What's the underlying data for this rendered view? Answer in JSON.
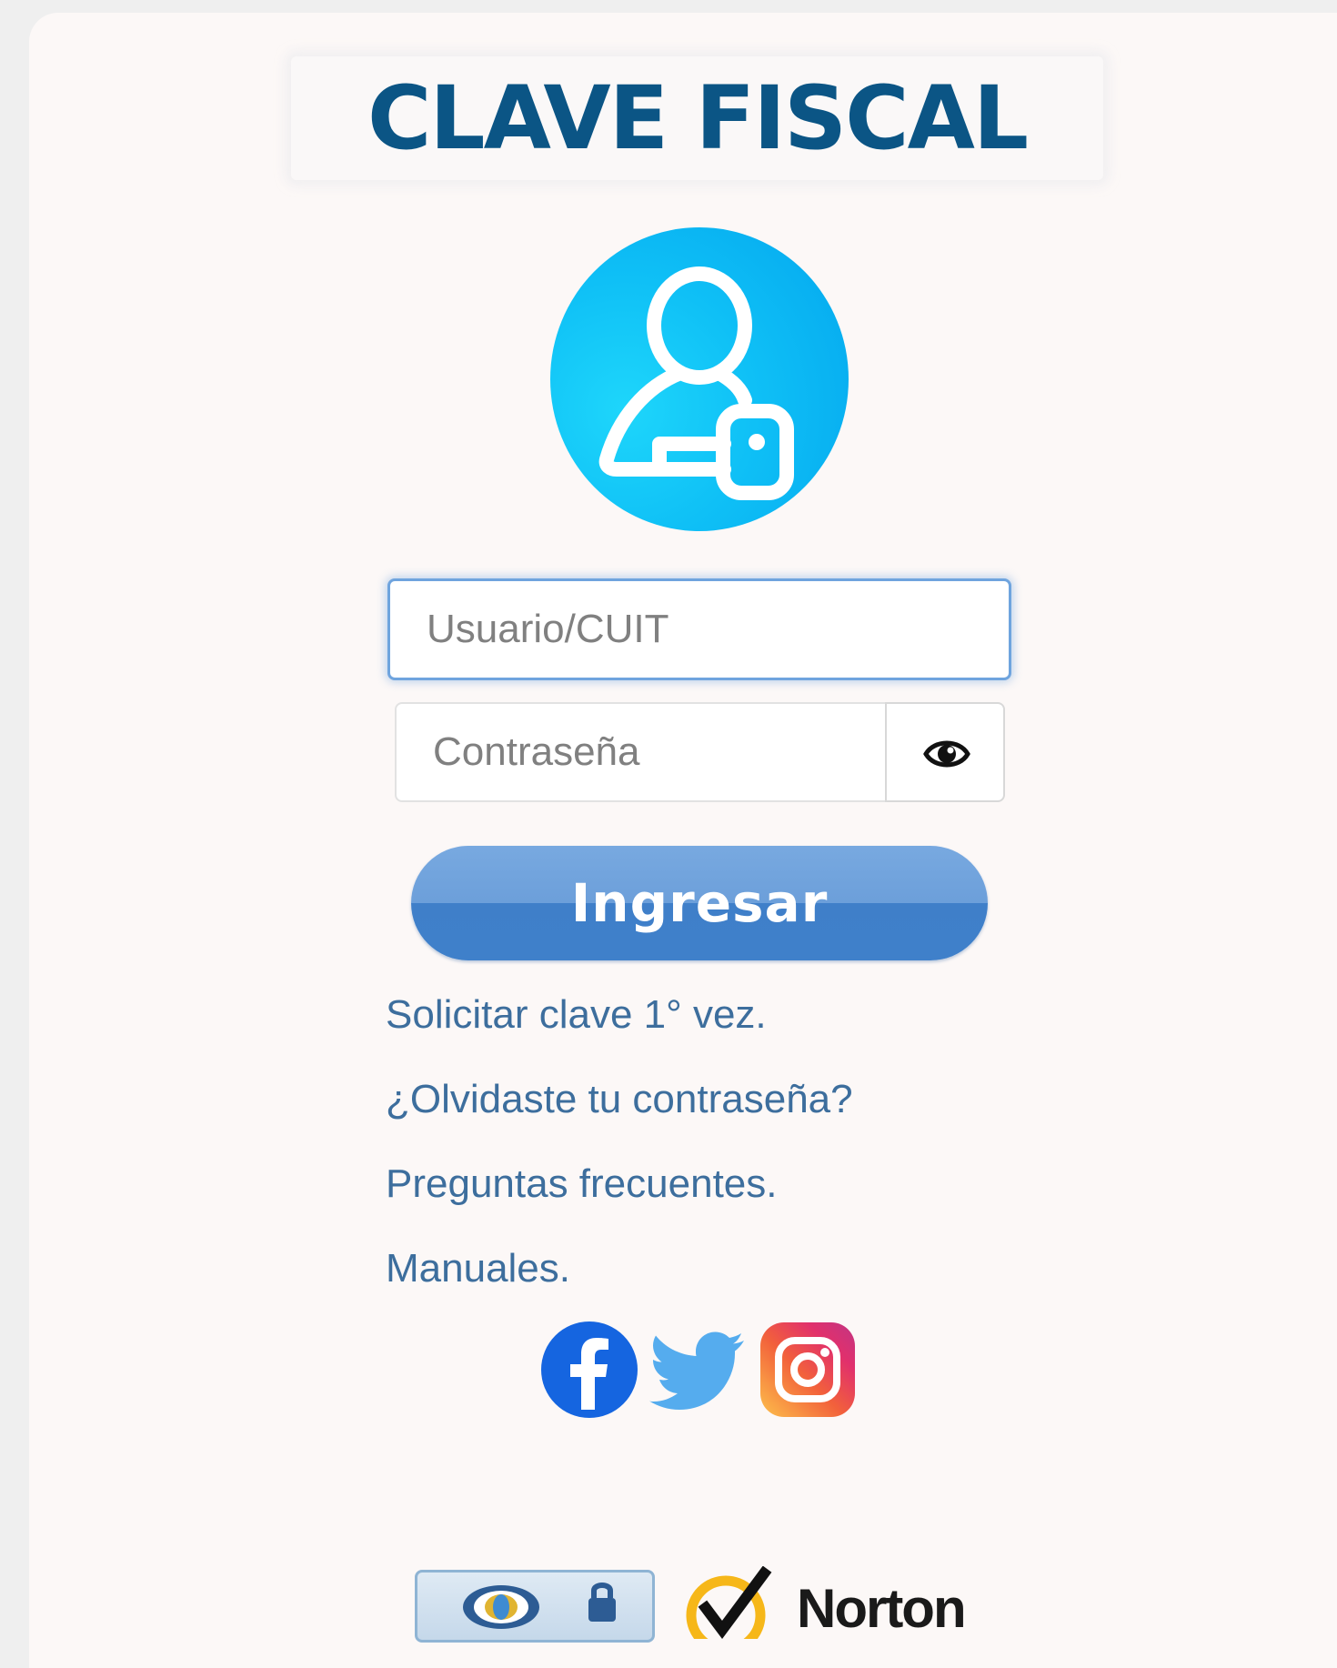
{
  "header": {
    "title": "CLAVE FISCAL"
  },
  "form": {
    "user_placeholder": "Usuario/CUIT",
    "password_placeholder": "Contraseña",
    "submit_label": "Ingresar"
  },
  "links": [
    "Solicitar clave 1° vez.",
    "¿Olvidaste tu contraseña?",
    "Preguntas frecuentes.",
    "Manuales."
  ],
  "social": [
    "facebook-icon",
    "twitter-icon",
    "instagram-icon"
  ],
  "badges": {
    "norton_label": "Norton"
  },
  "colors": {
    "title": "#0b5585",
    "avatar": "#0fc0f6",
    "button": "#5b93d4",
    "link": "#3d6e9d",
    "facebook": "#1877f2",
    "twitter": "#55acee"
  }
}
